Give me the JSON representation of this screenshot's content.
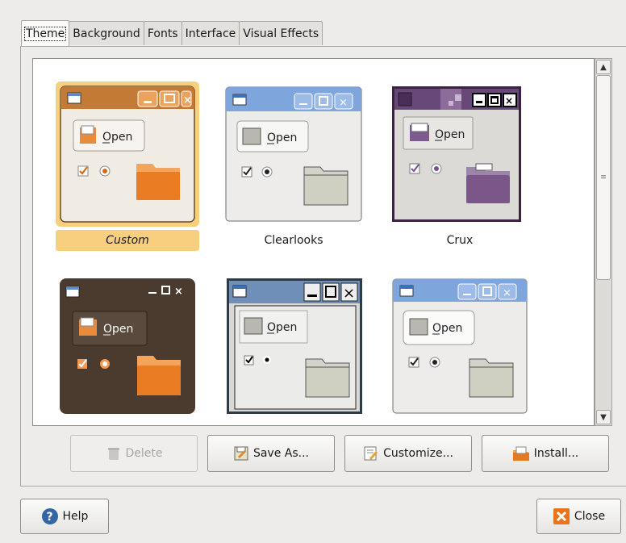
{
  "tabs": [
    "Theme",
    "Background",
    "Fonts",
    "Interface",
    "Visual Effects"
  ],
  "themes": [
    {
      "name": "Custom",
      "selected": true,
      "open_label": "Open"
    },
    {
      "name": "Clearlooks",
      "selected": false,
      "open_label": "Open"
    },
    {
      "name": "Crux",
      "selected": false,
      "open_label": "Open"
    },
    {
      "name": "",
      "selected": false,
      "open_label": "Open"
    },
    {
      "name": "",
      "selected": false,
      "open_label": "Open"
    },
    {
      "name": "",
      "selected": false,
      "open_label": "Open"
    }
  ],
  "buttons": {
    "delete": "Delete",
    "save_as": "Save As...",
    "customize": "Customize...",
    "install": "Install...",
    "help": "Help",
    "close": "Close"
  },
  "colors": {
    "selection": "#f7cf7f",
    "custom_accent": "#e07b2a",
    "clearlooks_accent": "#6f9bd7",
    "crux_accent": "#6b4a7e"
  }
}
